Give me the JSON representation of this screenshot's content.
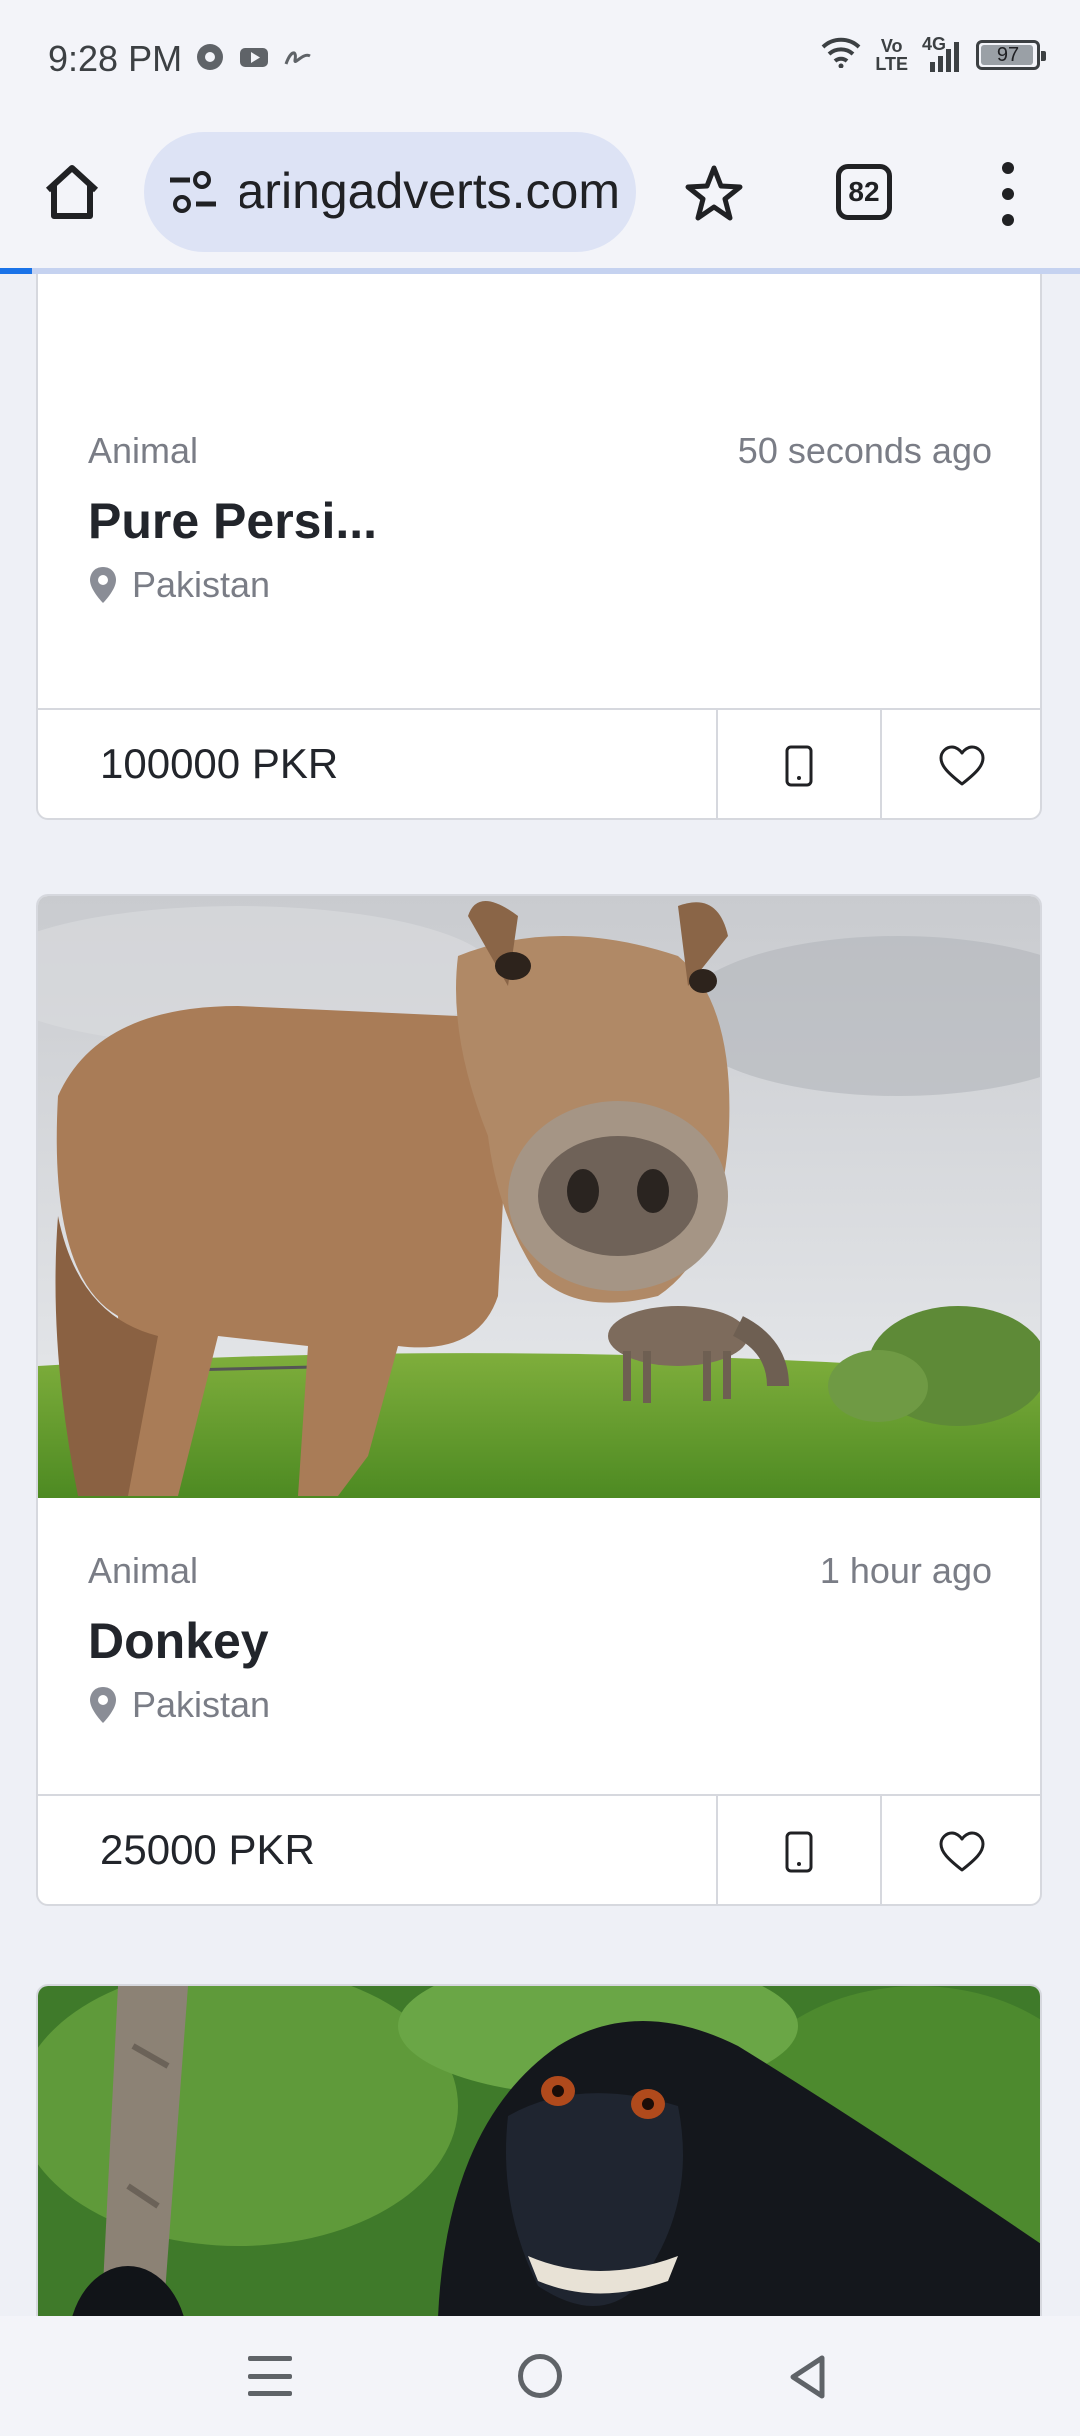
{
  "status_bar": {
    "time": "9:28 PM",
    "app_icons": [
      "chrome-icon",
      "youtube-icon",
      "signature-icon"
    ],
    "volte_top": "Vo",
    "volte_bottom": "LTE",
    "network": "4G",
    "battery": "97",
    "battery_level": 0.97
  },
  "browser": {
    "url": "aringadverts.com",
    "tab_count": "82",
    "load_progress": 0.03,
    "accent": "#1a73e8"
  },
  "listings": [
    {
      "category": "Animal",
      "time_ago": "50 seconds ago",
      "title": "Pure Persi...",
      "location": "Pakistan",
      "price": "100000 PKR"
    },
    {
      "category": "Animal",
      "time_ago": "1 hour ago",
      "title": "Donkey",
      "location": "Pakistan",
      "price": "25000 PKR"
    }
  ]
}
